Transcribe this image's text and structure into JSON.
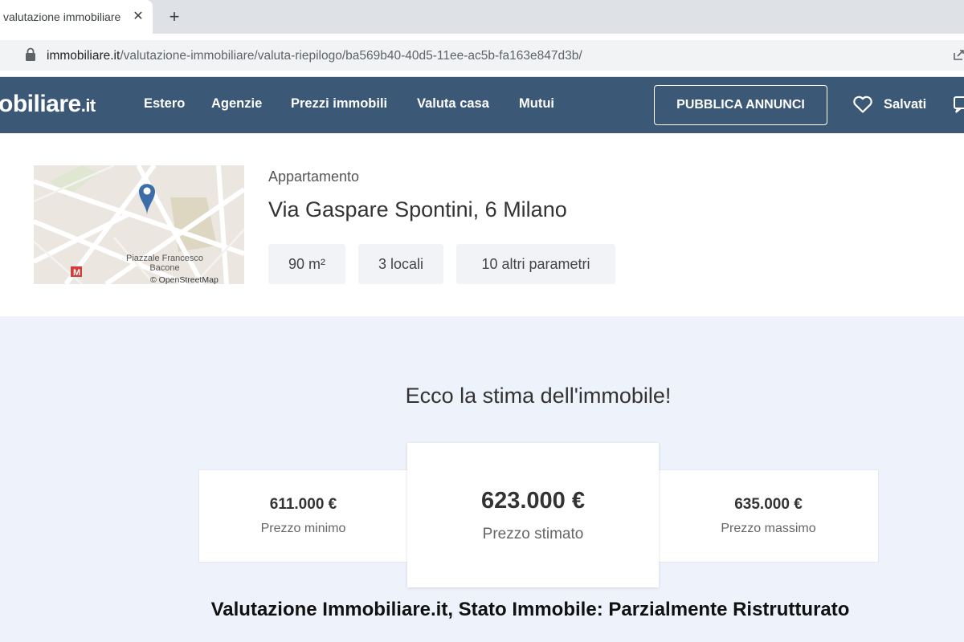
{
  "browser": {
    "tab_title": "valutazione immobiliare",
    "url_host": "immobiliare.it",
    "url_path": "/valutazione-immobiliare/valuta-riepilogo/ba569b40-40d5-11ee-ac5b-fa163e847d3b/"
  },
  "header": {
    "logo_main": "obiliare",
    "logo_tld": ".it",
    "nav": [
      "Estero",
      "Agenzie",
      "Prezzi immobili",
      "Valuta casa",
      "Mutui"
    ],
    "publish_label": "PUBBLICA ANNUNCI",
    "saved_label": "Salvati",
    "bg_color": "#3b5877"
  },
  "property": {
    "map_label": "Piazzale Francesco Bacone",
    "map_attribution": "© OpenStreetMap",
    "type": "Appartamento",
    "address": "Via Gaspare Spontini, 6 Milano",
    "chips": [
      "90 m²",
      "3 locali",
      "10 altri parametri"
    ]
  },
  "estimate": {
    "title": "Ecco la stima dell'immobile!",
    "min": {
      "price": "611.000 €",
      "label": "Prezzo minimo"
    },
    "estimated": {
      "price": "623.000 €",
      "label": "Prezzo stimato"
    },
    "max": {
      "price": "635.000 €",
      "label": "Prezzo massimo"
    }
  },
  "caption": "Valutazione Immobiliare.it, Stato Immobile: Parzialmente Ristrutturato",
  "icons": {
    "lock": "lock-icon",
    "close": "close-icon",
    "plus": "plus-icon",
    "heart": "heart-icon",
    "message": "message-icon",
    "pin": "map-pin-icon",
    "metro": "metro-icon"
  }
}
